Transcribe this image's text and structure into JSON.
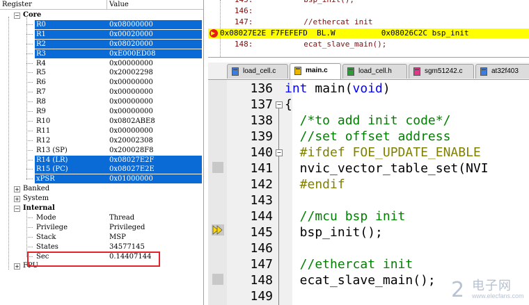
{
  "registers": {
    "col_register": "Register",
    "col_value": "Value",
    "core_label": "Core",
    "core": [
      {
        "name": "R0",
        "value": "0x08000000",
        "selected": true
      },
      {
        "name": "R1",
        "value": "0x00020000",
        "selected": true
      },
      {
        "name": "R2",
        "value": "0x08020000",
        "selected": true
      },
      {
        "name": "R3",
        "value": "0xE000ED08",
        "selected": true
      },
      {
        "name": "R4",
        "value": "0x00000000",
        "selected": false
      },
      {
        "name": "R5",
        "value": "0x20002298",
        "selected": false
      },
      {
        "name": "R6",
        "value": "0x00000000",
        "selected": false
      },
      {
        "name": "R7",
        "value": "0x00000000",
        "selected": false
      },
      {
        "name": "R8",
        "value": "0x00000000",
        "selected": false
      },
      {
        "name": "R9",
        "value": "0x00000000",
        "selected": false
      },
      {
        "name": "R10",
        "value": "0x0802ABE8",
        "selected": false
      },
      {
        "name": "R11",
        "value": "0x00000000",
        "selected": false
      },
      {
        "name": "R12",
        "value": "0x20002308",
        "selected": false
      },
      {
        "name": "R13 (SP)",
        "value": "0x200028F8",
        "selected": false
      },
      {
        "name": "R14 (LR)",
        "value": "0x08027E2F",
        "selected": true
      },
      {
        "name": "R15 (PC)",
        "value": "0x08027E2E",
        "selected": true
      },
      {
        "name": "xPSR",
        "value": "0x01000000",
        "selected": true
      }
    ],
    "banked_label": "Banked",
    "system_label": "System",
    "internal_label": "Internal",
    "internal": [
      {
        "name": "Mode",
        "value": "Thread"
      },
      {
        "name": "Privilege",
        "value": "Privileged"
      },
      {
        "name": "Stack",
        "value": "MSP"
      },
      {
        "name": "States",
        "value": "34577145"
      },
      {
        "name": "Sec",
        "value": "0.14407144"
      }
    ],
    "fpu_label": "FPU"
  },
  "disassembly": {
    "lines": [
      {
        "text": "   145:           bsp_init();"
      },
      {
        "text": "   146:"
      },
      {
        "text": "   147:           //ethercat init"
      },
      {
        "text": "0x08027E2E F7FEFEFD  BL.W          0x08026C2C bsp_init",
        "current": true
      },
      {
        "text": "   148:           ecat_slave_main();"
      }
    ]
  },
  "tabs": [
    {
      "label": "load_cell.c",
      "active": false,
      "color": "#3d7de0"
    },
    {
      "label": "main.c",
      "active": true,
      "color": "#e8b800"
    },
    {
      "label": "load_cell.h",
      "active": false,
      "color": "#2e9a3a"
    },
    {
      "label": "sgm51242.c",
      "active": false,
      "color": "#e0398c"
    },
    {
      "label": "at32f403",
      "active": false,
      "color": "#3d7de0"
    }
  ],
  "editor": {
    "lines": [
      {
        "num": "136",
        "segments": [
          {
            "t": "int",
            "c": "kw"
          },
          {
            "t": " main(",
            "c": ""
          },
          {
            "t": "void",
            "c": "kw"
          },
          {
            "t": ")",
            "c": ""
          }
        ]
      },
      {
        "num": "137",
        "segments": [
          {
            "t": "{",
            "c": ""
          }
        ]
      },
      {
        "num": "138",
        "segments": [
          {
            "t": "  /*to add init code*/",
            "c": "cm"
          }
        ]
      },
      {
        "num": "139",
        "segments": [
          {
            "t": "  //set offset address",
            "c": "cm"
          }
        ]
      },
      {
        "num": "140",
        "segments": [
          {
            "t": "  #ifdef FOE_UPDATE_ENABLE",
            "c": "pp"
          }
        ]
      },
      {
        "num": "141",
        "segments": [
          {
            "t": "  nvic_vector_table_set(NVI",
            "c": ""
          }
        ]
      },
      {
        "num": "142",
        "segments": [
          {
            "t": "  #endif",
            "c": "pp"
          }
        ]
      },
      {
        "num": "143",
        "segments": []
      },
      {
        "num": "144",
        "segments": [
          {
            "t": "  //mcu bsp init",
            "c": "cm"
          }
        ]
      },
      {
        "num": "145",
        "segments": [
          {
            "t": "  bsp_init();",
            "c": ""
          }
        ]
      },
      {
        "num": "146",
        "segments": []
      },
      {
        "num": "147",
        "segments": [
          {
            "t": "  //ethercat init",
            "c": "cm"
          }
        ]
      },
      {
        "num": "148",
        "segments": [
          {
            "t": "  ecat_slave_main();",
            "c": ""
          }
        ]
      },
      {
        "num": "149",
        "segments": []
      }
    ]
  },
  "watermark": {
    "text": "电子网",
    "url": "www.elecfans.com"
  }
}
